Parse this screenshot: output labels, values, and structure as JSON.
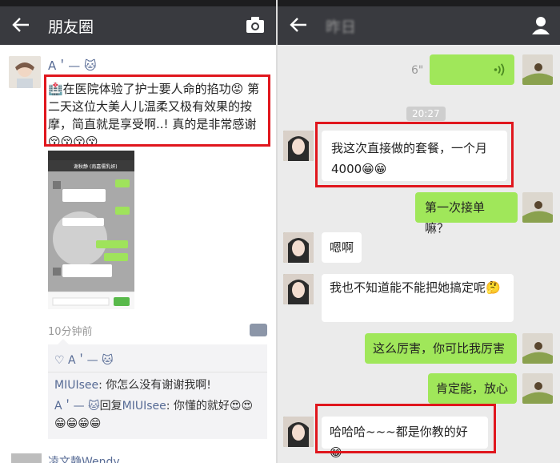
{
  "left": {
    "nav_title": "朋友圈",
    "post": {
      "user": "A＇— 🐱",
      "text": "🏥在医院体验了护士要人命的掐功😡 第二天这位大美人儿温柔又极有效果的按摩，简直就是享受啊..! 真的是非常感谢😚😚😚😚",
      "time": "10分钟前"
    },
    "screenshot_title": "谢秋静 (南嘉儒乳妍)",
    "comments": {
      "likes": "♡ A＇— 🐱",
      "c1_user": "MIUIsee",
      "c1_text": ": 你怎么没有谢谢我啊!",
      "c2_user": "A＇— 🐱",
      "c2_reply": "回复",
      "c2_target": "MIUIsee",
      "c2_text": ": 你懂的就好😍😍😁😁😁😁"
    },
    "next_user": "凌文静Wendy"
  },
  "right": {
    "nav_title": "昨日",
    "voice_seconds": "6\"",
    "time_label": "20:27",
    "messages": [
      {
        "side": "left",
        "text": "我这次直接做的套餐，一个月4000😁😁"
      },
      {
        "side": "right",
        "text": "第一次接单嘛？"
      },
      {
        "side": "left",
        "text": "嗯啊"
      },
      {
        "side": "left",
        "text": "我也不知道能不能把她搞定呢🤔"
      },
      {
        "side": "right",
        "text": "这么厉害，你可比我厉害"
      },
      {
        "side": "right",
        "text": "肯定能，放心"
      },
      {
        "side": "left",
        "text": "哈哈哈~~~都是你教的好😁"
      }
    ]
  },
  "colors": {
    "navbar": "#393a3f",
    "green_bubble": "#a0e75a",
    "link_blue": "#576b95",
    "highlight_red": "#e0161d"
  }
}
